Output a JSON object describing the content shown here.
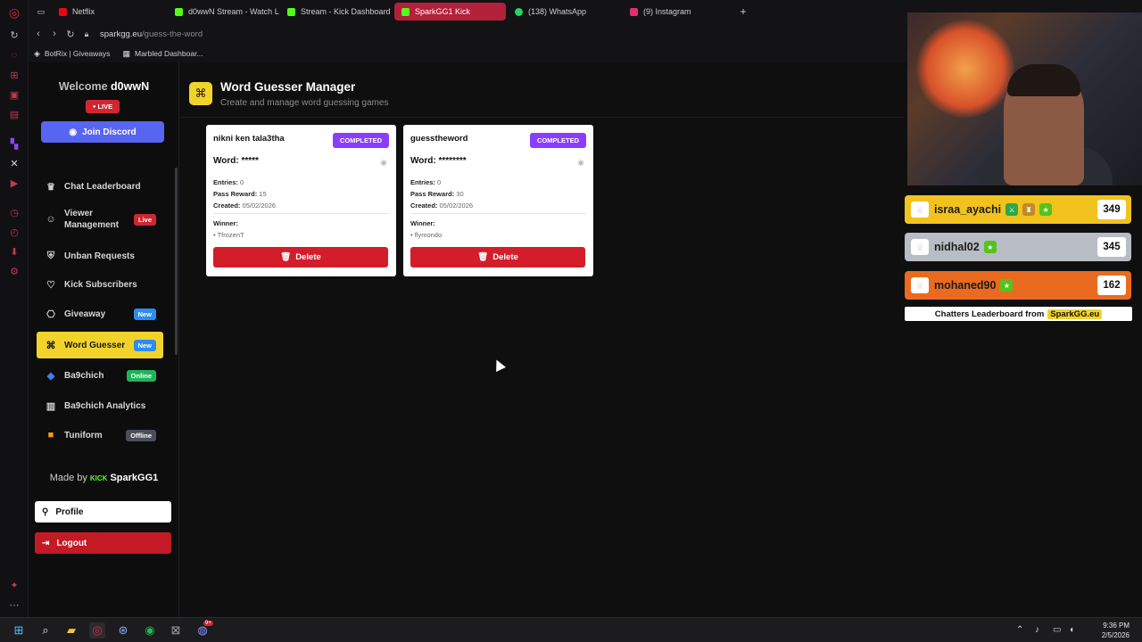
{
  "browser": {
    "tabs": [
      {
        "label": "Netflix",
        "color": "#e50914",
        "active": false
      },
      {
        "label": "d0wwN Stream - Watch L",
        "color": "#53fc18",
        "active": false
      },
      {
        "label": "Stream - Kick Dashboard",
        "color": "#53fc18",
        "active": false
      },
      {
        "label": "SparkGG1 Kick",
        "color": "#53fc18",
        "active": true
      },
      {
        "label": "(138) WhatsApp",
        "color": "#25d366",
        "active": false
      },
      {
        "label": "(9) Instagram",
        "color": "#e1306c",
        "active": false
      }
    ],
    "new_tab": "+",
    "url_host": "sparkgg.eu",
    "url_path": "/guess-the-word",
    "bookmarks": [
      "BotRix | Giveaways",
      "Marbled Dashboar..."
    ]
  },
  "sidebar": {
    "welcome_prefix": "Welcome",
    "username": "d0wwN",
    "live_label": "LIVE",
    "discord_label": "Join Discord",
    "nav_items": [
      {
        "label": "Chat Leaderboard",
        "icon": "trophy-icon",
        "glyph": "♛",
        "badge": null
      },
      {
        "label": "Viewer Management",
        "icon": "users-icon",
        "glyph": "☺",
        "badge": "Live",
        "badge_color": "#d12630"
      },
      {
        "label": "Unban Requests",
        "icon": "shield-icon",
        "glyph": "⛨",
        "badge": null
      },
      {
        "label": "Kick Subscribers",
        "icon": "heart-icon",
        "glyph": "♡",
        "badge": null
      },
      {
        "label": "Giveaway",
        "icon": "gift-icon",
        "glyph": "⎔",
        "badge": "New",
        "badge_color": "#2c8cf0"
      },
      {
        "label": "Word Guesser",
        "icon": "gamepad-icon",
        "glyph": "⌘",
        "badge": "New",
        "badge_color": "#2c8cf0",
        "active": true
      },
      {
        "label": "Ba9chich",
        "icon": "ba9chich-logo-icon",
        "glyph": "◆",
        "badge": "Online",
        "badge_color": "#1fb45a"
      },
      {
        "label": "Ba9chich Analytics",
        "icon": "bar-chart-icon",
        "glyph": "▥",
        "badge": null
      },
      {
        "label": "Tuniform",
        "icon": "tuniform-logo-icon",
        "glyph": "■",
        "badge": "Offline",
        "badge_color": "#4a4f58"
      }
    ],
    "made_by_prefix": "Made by",
    "made_by_kick": "KICK",
    "made_by_name": "SparkGG1",
    "profile_label": "Profile",
    "logout_label": "Logout"
  },
  "main": {
    "title": "Word Guesser Manager",
    "subtitle": "Create and manage word guessing games",
    "games": [
      {
        "title": "nikni ken tala3tha",
        "status": "COMPLETED",
        "word_label": "Word:",
        "word_masked": "*****",
        "entries_label": "Entries:",
        "entries": "0",
        "reward_label": "Pass Reward:",
        "reward": "15",
        "created_label": "Created:",
        "created": "05/02/2026",
        "winner_label": "Winner:",
        "winner": "• TfrozenT",
        "delete_label": "Delete"
      },
      {
        "title": "guesstheword",
        "status": "COMPLETED",
        "word_label": "Word:",
        "word_masked": "********",
        "entries_label": "Entries:",
        "entries": "0",
        "reward_label": "Pass Reward:",
        "reward": "30",
        "created_label": "Created:",
        "created": "05/02/2026",
        "winner_label": "Winner:",
        "winner": "• flymondo",
        "delete_label": "Delete"
      }
    ]
  },
  "overlay": {
    "leaderboard": [
      {
        "name": "israa_ayachi",
        "score": "349",
        "bg": "#f2c21f"
      },
      {
        "name": "nidhal02",
        "score": "345",
        "bg": "#b8bcc4"
      },
      {
        "name": "mohaned90",
        "score": "162",
        "bg": "#ea6b1f"
      }
    ],
    "footer_text": "Chatters Leaderboard from",
    "footer_brand": "SparkGG.eu"
  },
  "taskbar": {
    "time": "9:36 PM",
    "date": "2/5/2026",
    "discord_badge": "9+"
  }
}
